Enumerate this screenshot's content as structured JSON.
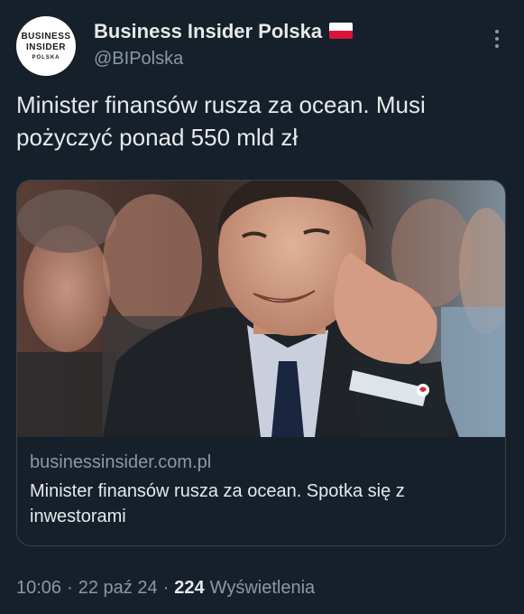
{
  "author": {
    "avatar_text": [
      "BUSINESS",
      "INSIDER",
      "POLSKA"
    ],
    "name": "Business Insider Polska",
    "flag": "flag-poland-icon",
    "handle": "@BIPolska"
  },
  "tweet": {
    "text": "Minister finansów rusza za ocean. Musi pożyczyć ponad 550 mld zł"
  },
  "card": {
    "domain": "businessinsider.com.pl",
    "title": "Minister finansów rusza za ocean. Spotka się z inwestorami"
  },
  "footer": {
    "time": "10:06",
    "date": "22 paź 24",
    "views_count": "224",
    "views_label": "Wyświetlenia"
  },
  "colors": {
    "background": "#15202b",
    "text_primary": "#e7e9ea",
    "text_secondary": "#8b98a5",
    "border": "#38444d"
  }
}
